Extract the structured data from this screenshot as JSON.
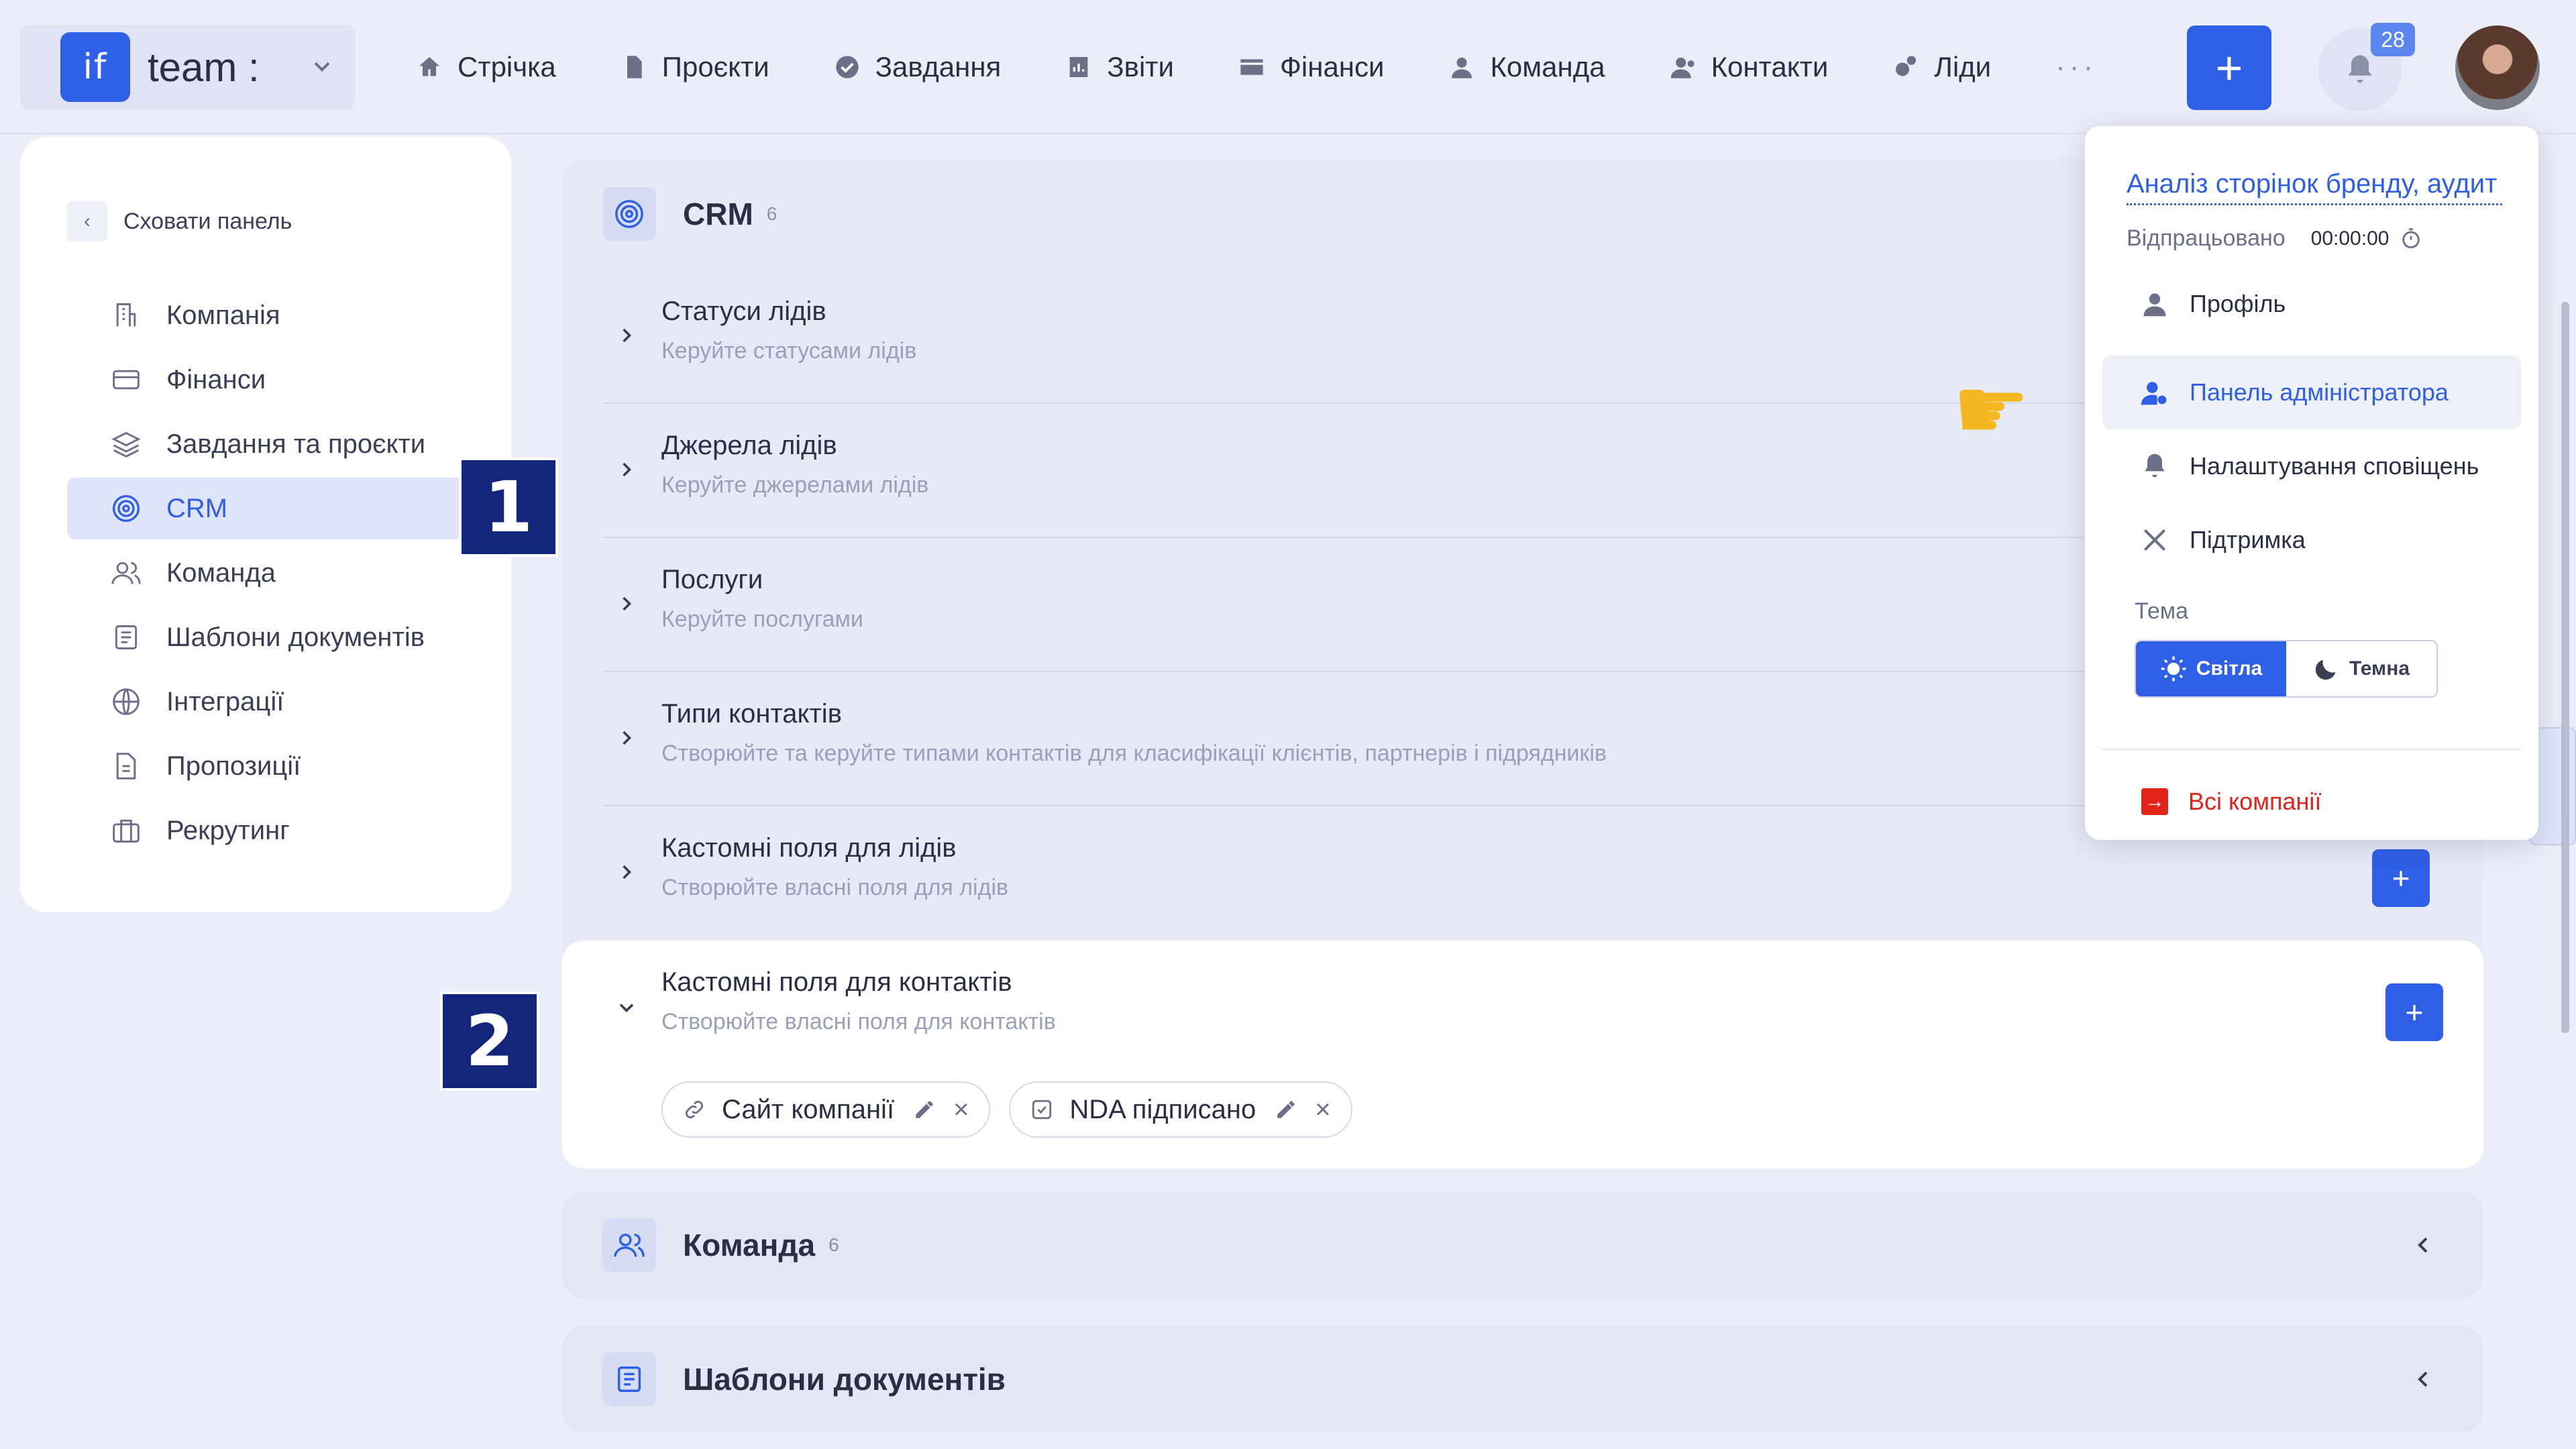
{
  "brand": {
    "logo": "if",
    "name": "team :"
  },
  "nav": [
    {
      "icon": "home-icon",
      "label": "Стрічка"
    },
    {
      "icon": "document-icon",
      "label": "Проєкти"
    },
    {
      "icon": "check-circle-icon",
      "label": "Завдання"
    },
    {
      "icon": "report-icon",
      "label": "Звіти"
    },
    {
      "icon": "wallet-icon",
      "label": "Фінанси"
    },
    {
      "icon": "person-icon",
      "label": "Команда"
    },
    {
      "icon": "contacts-icon",
      "label": "Контакти"
    },
    {
      "icon": "leads-icon",
      "label": "Ліди"
    }
  ],
  "nav_more": "···",
  "header": {
    "add_label": "+",
    "notifications_count": "28"
  },
  "sidebar": {
    "hide_label": "Сховати панель",
    "items": [
      {
        "label": "Компанія",
        "icon": "company-icon"
      },
      {
        "label": "Фінанси",
        "icon": "finance-card-icon"
      },
      {
        "label": "Завдання та проєкти",
        "icon": "layers-icon"
      },
      {
        "label": "CRM",
        "icon": "target-icon",
        "active": true
      },
      {
        "label": "Команда",
        "icon": "team-icon"
      },
      {
        "label": "Шаблони документів",
        "icon": "template-icon"
      },
      {
        "label": "Інтеграції",
        "icon": "globe-icon"
      },
      {
        "label": "Пропозиції",
        "icon": "proposal-icon"
      },
      {
        "label": "Рекрутинг",
        "icon": "briefcase-icon"
      }
    ]
  },
  "markers": {
    "one": "1",
    "two": "2"
  },
  "crm": {
    "title": "CRM",
    "count": "6",
    "rows": [
      {
        "title": "Статуси лідів",
        "subtitle": "Керуйте статусами лідів"
      },
      {
        "title": "Джерела лідів",
        "subtitle": "Керуйте джерелами лідів"
      },
      {
        "title": "Послуги",
        "subtitle": "Керуйте послугами"
      },
      {
        "title": "Типи контактів",
        "subtitle": "Створюйте та керуйте типами контактів для класифікації клієнтів, партнерів і підрядників"
      },
      {
        "title": "Кастомні поля для лідів",
        "subtitle": "Створюйте власні поля для лідів",
        "add_label": "+"
      },
      {
        "title": "Кастомні поля для контактів",
        "subtitle": "Створюйте власні поля для контактів",
        "add_label": "+"
      }
    ],
    "chips": [
      {
        "label": "Сайт компанії",
        "icon": "link-icon"
      },
      {
        "label": "NDA підписано",
        "icon": "checkbox-icon"
      }
    ]
  },
  "team_section": {
    "title": "Команда",
    "count": "6"
  },
  "templates_section": {
    "title": "Шаблони документів"
  },
  "dropdown": {
    "task": "Аналіз сторінок бренду, аудит",
    "worked_label": "Відпрацьовано",
    "worked_time": "00:00:00",
    "items": [
      {
        "label": "Профіль",
        "icon": "profile-icon"
      },
      {
        "label": "Панель адміністратора",
        "icon": "admin-icon",
        "highlighted": true
      },
      {
        "label": "Налаштування сповіщень",
        "icon": "bell-icon"
      },
      {
        "label": "Підтримка",
        "icon": "tools-icon"
      }
    ],
    "theme_label": "Тема",
    "theme_light": "Світла",
    "theme_dark": "Темна",
    "all_companies": "Всі компанії"
  },
  "colors": {
    "accent": "#2f5fe6",
    "danger": "#e2231a",
    "marker": "#14267c"
  }
}
